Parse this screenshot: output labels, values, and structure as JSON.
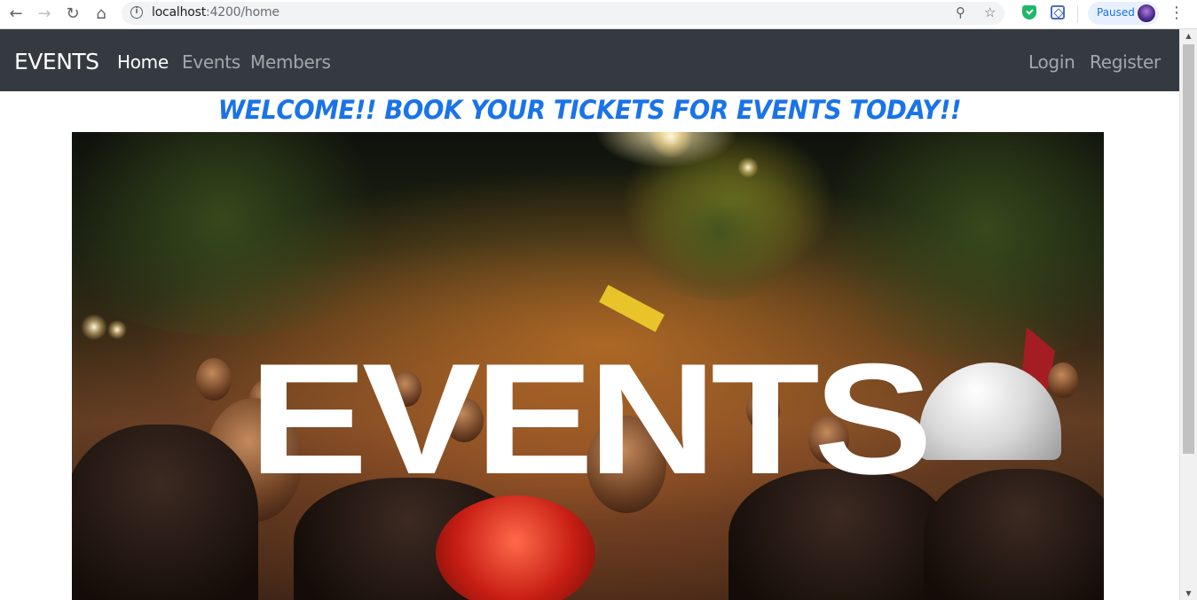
{
  "browser": {
    "url_host": "localhost",
    "url_rest": ":4200/home",
    "profile_status": "Paused",
    "icons": {
      "back": "arrow-left-icon",
      "forward": "arrow-right-icon",
      "reload": "reload-icon",
      "home": "home-icon",
      "site_info": "info-icon",
      "zoom": "zoom-icon",
      "bookmark": "star-icon",
      "menu": "kebab-menu-icon"
    }
  },
  "navbar": {
    "brand": "EVENTS",
    "links": [
      {
        "label": "Home",
        "active": true
      },
      {
        "label": "Events",
        "active": false
      },
      {
        "label": "Members",
        "active": false
      }
    ],
    "right_links": [
      {
        "label": "Login"
      },
      {
        "label": "Register"
      }
    ]
  },
  "main": {
    "welcome": "WELCOME!! BOOK YOUR TICKETS FOR EVENTS TODAY!!",
    "hero_text": "EVENTS"
  },
  "colors": {
    "navbar_bg": "#343a40",
    "welcome_text": "#1a73e8",
    "nav_active": "#ffffff",
    "nav_inactive": "rgba(255,255,255,0.55)"
  }
}
